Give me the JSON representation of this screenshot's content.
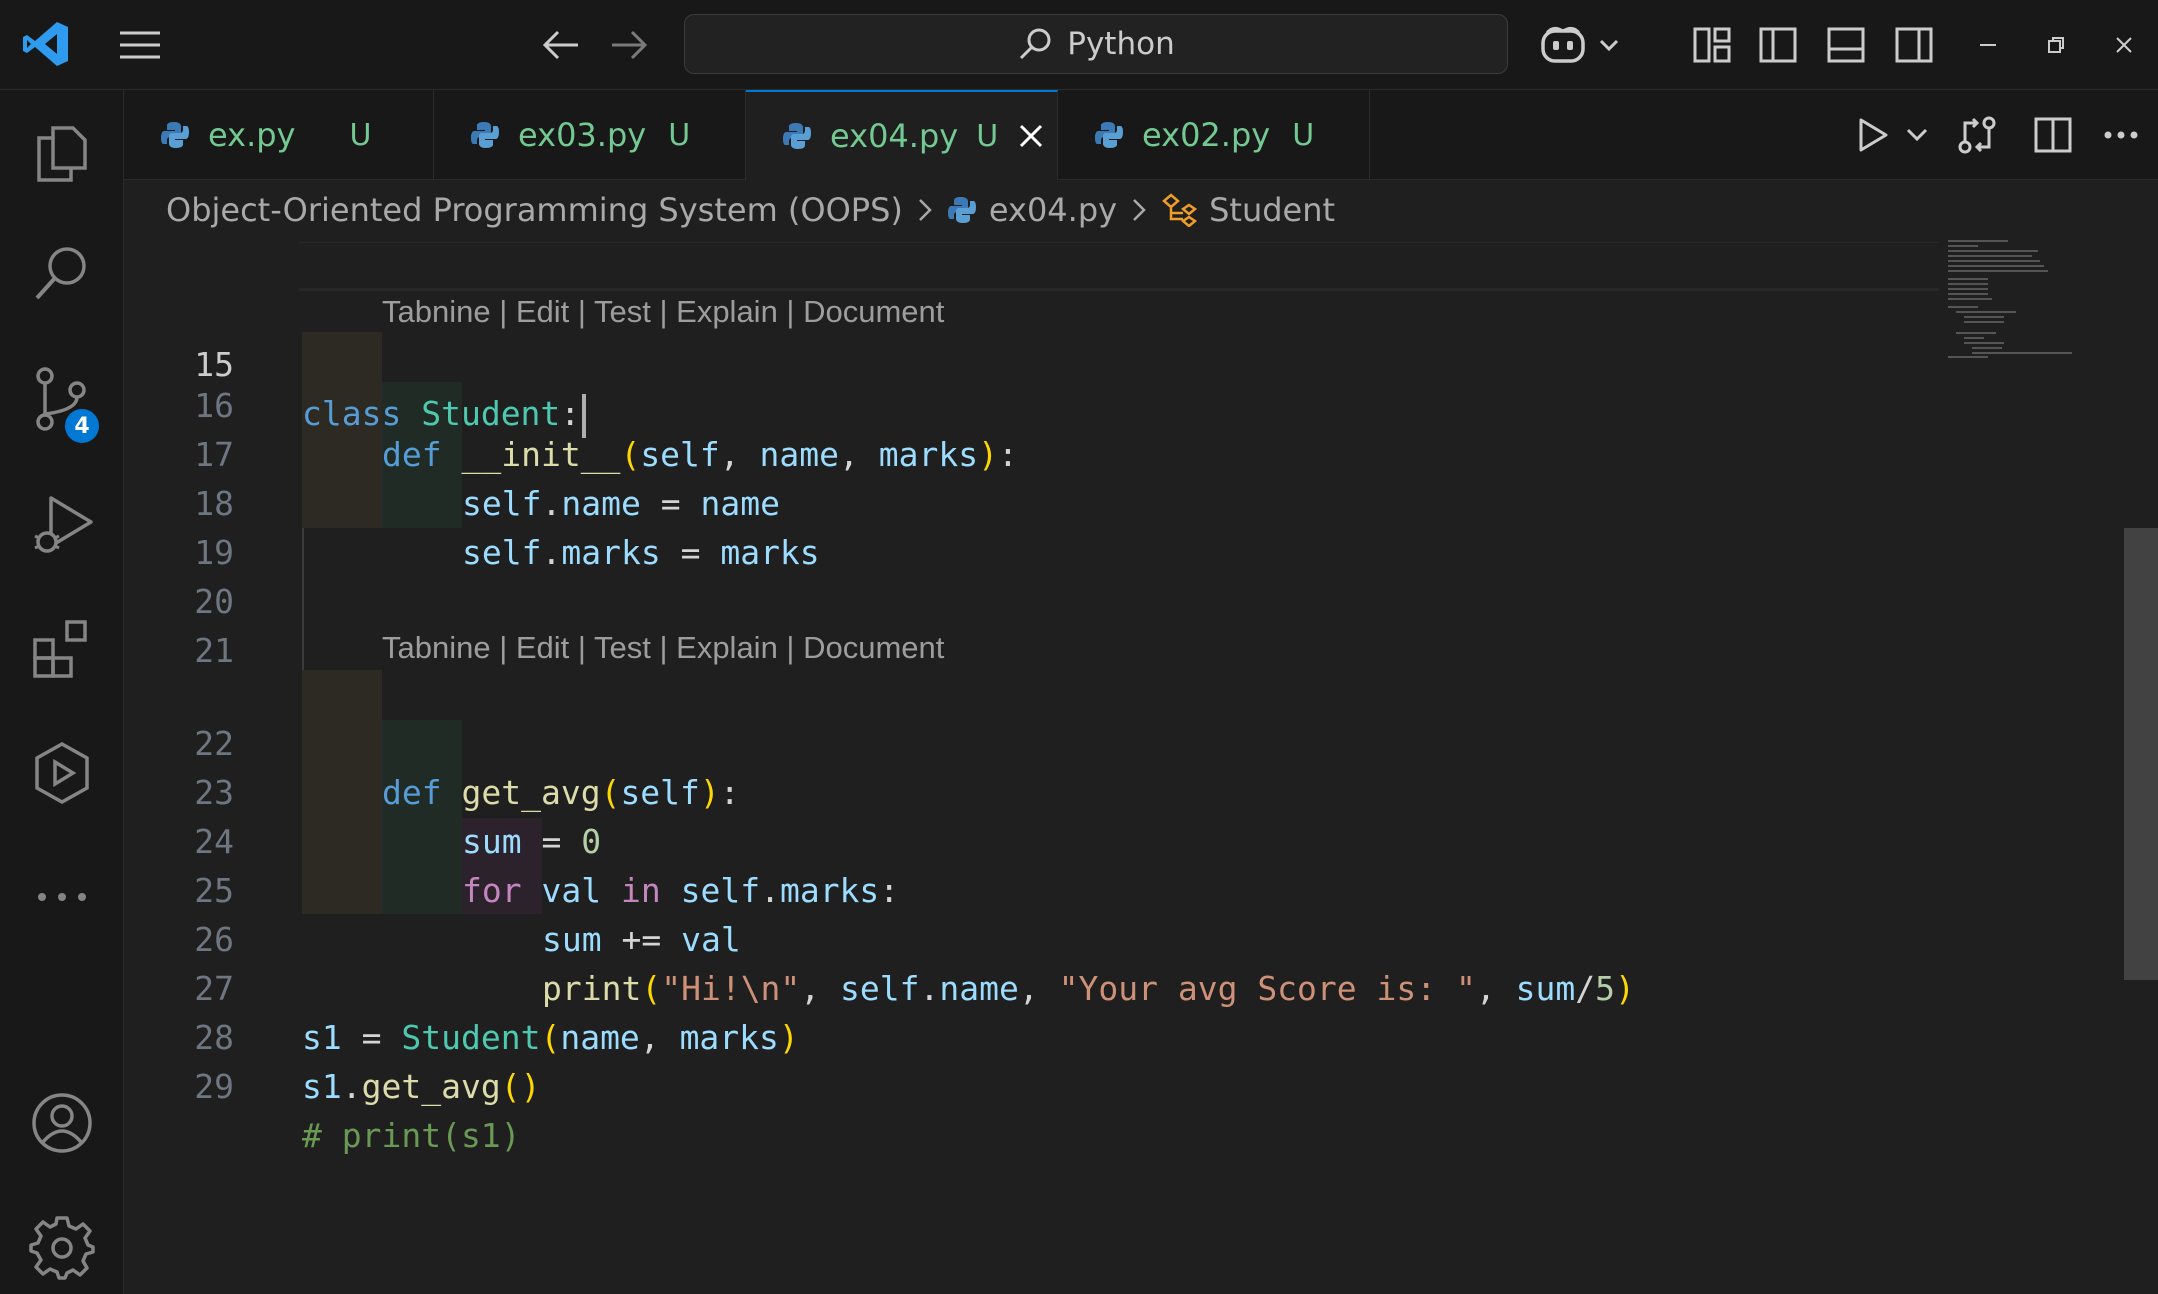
{
  "titlebar": {
    "search_label": "Python"
  },
  "activitybar": {
    "source_control_badge": "4"
  },
  "tabs": [
    {
      "name": "ex.py",
      "status": "U",
      "active": false
    },
    {
      "name": "ex03.py",
      "status": "U",
      "active": false
    },
    {
      "name": "ex04.py",
      "status": "U",
      "active": true
    },
    {
      "name": "ex02.py",
      "status": "U",
      "active": false
    }
  ],
  "breadcrumb": {
    "folder": "Object-Oriented Programming System (OOPS)",
    "file": "ex04.py",
    "symbol": "Student"
  },
  "codelens": {
    "text": "Tabnine | Edit | Test | Explain | Document"
  },
  "code": {
    "line_numbers": [
      "15",
      "16",
      "17",
      "18",
      "19",
      "20",
      "21",
      "22",
      "23",
      "24",
      "25",
      "26",
      "27",
      "28",
      "29"
    ],
    "l15": {
      "kw": "class",
      "cls": "Student",
      "colon": ":"
    },
    "l16": {
      "kw": "def",
      "fn": "__init__",
      "self": "self",
      "a1": "name",
      "a2": "marks"
    },
    "l17": {
      "self": "self",
      "attr": "name",
      "op": "=",
      "val": "name"
    },
    "l18": {
      "self": "self",
      "attr": "marks",
      "op": "=",
      "val": "marks"
    },
    "l22": {
      "kw": "def",
      "fn": "get_avg",
      "self": "self"
    },
    "l23": {
      "var": "sum",
      "op": "=",
      "num": "0"
    },
    "l24": {
      "kw": "for",
      "var": "val",
      "in": "in",
      "self": "self",
      "attr": "marks"
    },
    "l25": {
      "var": "sum",
      "op": "+=",
      "val": "val"
    },
    "l26": {
      "fn": "print",
      "s1": "\"Hi!\\n\"",
      "self": "self",
      "attr": "name",
      "s2": "\"Your avg Score is: \"",
      "sum": "sum",
      "div": "/",
      "num": "5"
    },
    "l27": {
      "var": "s1",
      "op": "=",
      "cls": "Student",
      "a1": "name",
      "a2": "marks"
    },
    "l28": {
      "var": "s1",
      "fn": "get_avg"
    },
    "l29": {
      "cmt": "# print(s1)"
    }
  }
}
